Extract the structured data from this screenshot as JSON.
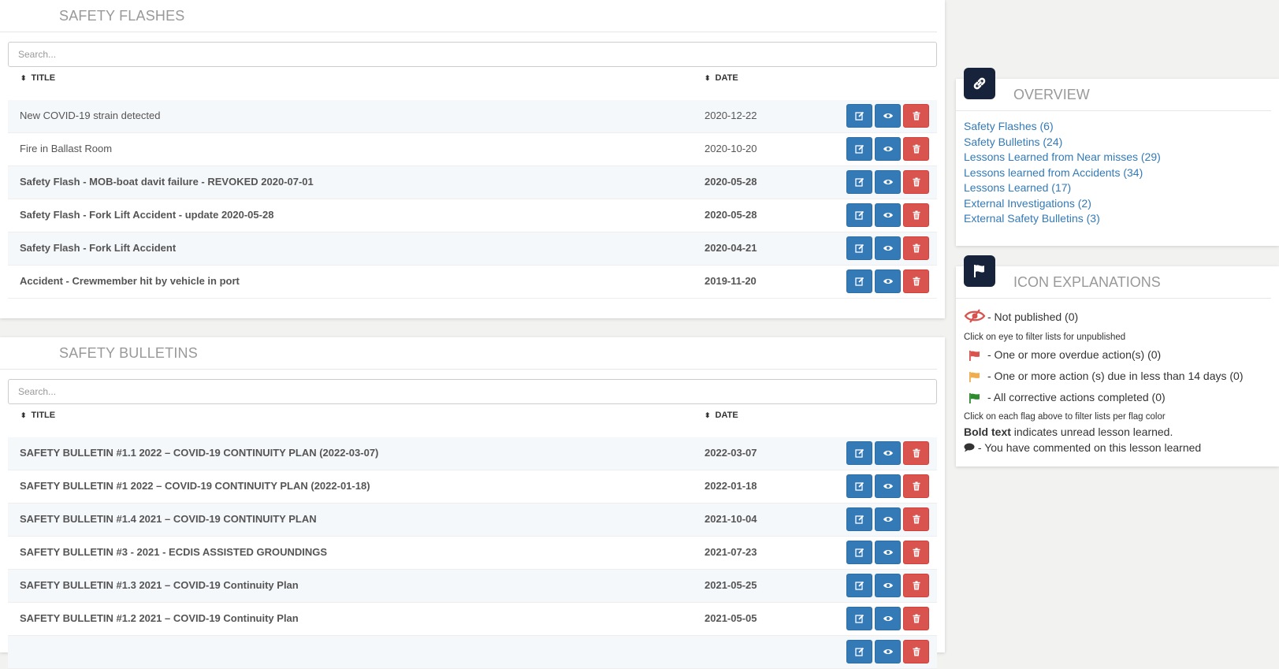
{
  "safety_flashes": {
    "title": "SAFETY FLASHES",
    "search_placeholder": "Search...",
    "col_title": "TITLE",
    "col_date": "DATE",
    "rows": [
      {
        "title": "New COVID-19 strain detected",
        "date": "2020-12-22",
        "bold": false
      },
      {
        "title": "Fire in Ballast Room",
        "date": "2020-10-20",
        "bold": false
      },
      {
        "title": "Safety Flash - MOB-boat davit failure - REVOKED 2020-07-01",
        "date": "2020-05-28",
        "bold": true
      },
      {
        "title": "Safety Flash - Fork Lift Accident - update 2020-05-28",
        "date": "2020-05-28",
        "bold": true
      },
      {
        "title": "Safety Flash - Fork Lift Accident",
        "date": "2020-04-21",
        "bold": true
      },
      {
        "title": "Accident - Crewmember hit by vehicle in port",
        "date": "2019-11-20",
        "bold": true
      }
    ]
  },
  "safety_bulletins": {
    "title": "SAFETY BULLETINS",
    "search_placeholder": "Search...",
    "col_title": "TITLE",
    "col_date": "DATE",
    "rows": [
      {
        "title": "SAFETY BULLETIN #1.1 2022 – COVID-19 CONTINUITY PLAN (2022-03-07)",
        "date": "2022-03-07",
        "bold": true
      },
      {
        "title": "SAFETY BULLETIN #1 2022 – COVID-19 CONTINUITY PLAN (2022-01-18)",
        "date": "2022-01-18",
        "bold": true
      },
      {
        "title": "SAFETY BULLETIN #1.4 2021 – COVID-19 CONTINUITY PLAN",
        "date": "2021-10-04",
        "bold": true
      },
      {
        "title": "SAFETY BULLETIN #3 - 2021 - ECDIS ASSISTED GROUNDINGS",
        "date": "2021-07-23",
        "bold": true
      },
      {
        "title": "SAFETY BULLETIN #1.3 2021 – COVID-19 Continuity Plan",
        "date": "2021-05-25",
        "bold": true
      },
      {
        "title": "SAFETY BULLETIN #1.2 2021 – COVID-19 Continuity Plan",
        "date": "2021-05-05",
        "bold": true
      },
      {
        "title": "",
        "date": "",
        "bold": true
      }
    ]
  },
  "overview": {
    "title": "OVERVIEW",
    "icon": "link-icon",
    "links": [
      "Safety Flashes (6)",
      "Safety Bulletins (24)",
      "Lessons Learned from Near misses (29)",
      "Lessons learned from Accidents (34)",
      "Lessons Learned (17)",
      "External Investigations (2)",
      "External Safety Bulletins (3)"
    ]
  },
  "icon_explanations": {
    "title": "ICON EXPLANATIONS",
    "icon": "flag-icon",
    "not_published": "- Not published (0)",
    "eye_note": "Click on eye to filter lists for unpublished",
    "red_flag": "- One or more overdue action(s) (0)",
    "orange_flag": "- One or more action (s) due in less than 14 days (0)",
    "green_flag": "- All corrective actions completed (0)",
    "flag_note": "Click on each flag above to filter lists per flag color",
    "bold_label": "Bold text",
    "bold_desc": " indicates unread lesson learned.",
    "comment_desc": "- You have commented on this lesson learned",
    "colors": {
      "red": "#d9534f",
      "orange": "#f0ad4e",
      "green": "#2e8b2e"
    }
  }
}
